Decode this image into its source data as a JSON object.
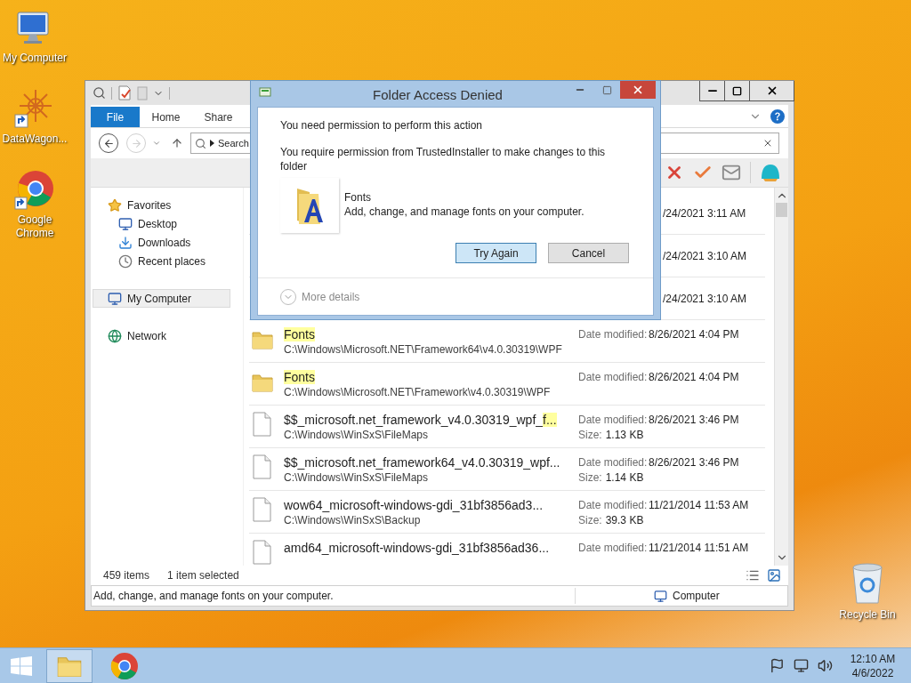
{
  "desktop_icons": [
    {
      "label": "My Computer",
      "kind": "computer"
    },
    {
      "label": "DataWagon...",
      "kind": "shortcut"
    },
    {
      "label": "Google Chrome",
      "kind": "chrome"
    },
    {
      "label": "Recycle Bin",
      "kind": "recycle"
    }
  ],
  "explorer": {
    "ribbon_tabs": [
      {
        "label": "File",
        "selected": true
      },
      {
        "label": "Home",
        "selected": false
      },
      {
        "label": "Share",
        "selected": false
      }
    ],
    "address": "Search",
    "nav": [
      {
        "label": "Favorites",
        "selected": false,
        "children": [
          {
            "label": "Desktop",
            "selected": false
          },
          {
            "label": "Downloads",
            "selected": false
          },
          {
            "label": "Recent places",
            "selected": false
          }
        ]
      },
      {
        "label": "My Computer",
        "selected": true
      },
      {
        "label": "Network",
        "selected": false
      }
    ],
    "results": [
      {
        "kind": "partial",
        "date": "/24/2021 3:11 AM"
      },
      {
        "kind": "partial",
        "date": "/24/2021 3:10 AM"
      },
      {
        "kind": "partial",
        "date": "/24/2021 3:10 AM"
      },
      {
        "kind": "folder",
        "name": [
          {
            "text": "Fonts",
            "highlighted": true
          }
        ],
        "path": "C:\\Windows\\Microsoft.NET\\Framework64\\v4.0.30319\\WPF",
        "date_label": "Date modified:",
        "date": "8/26/2021 4:04 PM"
      },
      {
        "kind": "folder",
        "name": [
          {
            "text": "Fonts",
            "highlighted": true
          }
        ],
        "path": "C:\\Windows\\Microsoft.NET\\Framework\\v4.0.30319\\WPF",
        "date_label": "Date modified:",
        "date": "8/26/2021 4:04 PM"
      },
      {
        "kind": "file",
        "name": [
          {
            "text": "$$_microsoft.net_framework_v4.0.30319_wpf_",
            "highlighted": false
          },
          {
            "text": "f...",
            "highlighted": true
          }
        ],
        "path": "C:\\Windows\\WinSxS\\FileMaps",
        "date_label": "Date modified:",
        "date": "8/26/2021 3:46 PM",
        "size_label": "Size:",
        "size": "1.13 KB"
      },
      {
        "kind": "file",
        "name": [
          {
            "text": "$$_microsoft.net_framework64_v4.0.30319_wpf...",
            "highlighted": false
          }
        ],
        "path": "C:\\Windows\\WinSxS\\FileMaps",
        "date_label": "Date modified:",
        "date": "8/26/2021 3:46 PM",
        "size_label": "Size:",
        "size": "1.14 KB"
      },
      {
        "kind": "file",
        "name": [
          {
            "text": "wow64_microsoft-windows-gdi_31bf3856ad3...",
            "highlighted": false
          }
        ],
        "path": "C:\\Windows\\WinSxS\\Backup",
        "date_label": "Date modified:",
        "date": "11/21/2014 11:53 AM",
        "size_label": "Size:",
        "size": "39.3 KB"
      },
      {
        "kind": "file",
        "name": [
          {
            "text": "amd64_microsoft-windows-gdi_31bf3856ad36...",
            "highlighted": false
          }
        ],
        "date_label": "Date modified:",
        "date": "11/21/2014 11:51 AM"
      }
    ],
    "status": {
      "count": "459 items",
      "selection": "1 item selected"
    },
    "details": {
      "description": "Add, change, and manage fonts on your computer.",
      "location": "Computer"
    }
  },
  "dialog": {
    "title": "Folder Access Denied",
    "heading": "You need permission to perform this action",
    "message": "You require permission from TrustedInstaller to make changes to this folder",
    "item_name": "Fonts",
    "item_description": "Add, change, and manage fonts on your computer.",
    "buttons": [
      {
        "label": "Try Again",
        "selected": true
      },
      {
        "label": "Cancel",
        "selected": false
      }
    ],
    "more_details": "More details"
  },
  "taskbar": {
    "time": "12:10 AM",
    "date": "4/6/2022"
  }
}
